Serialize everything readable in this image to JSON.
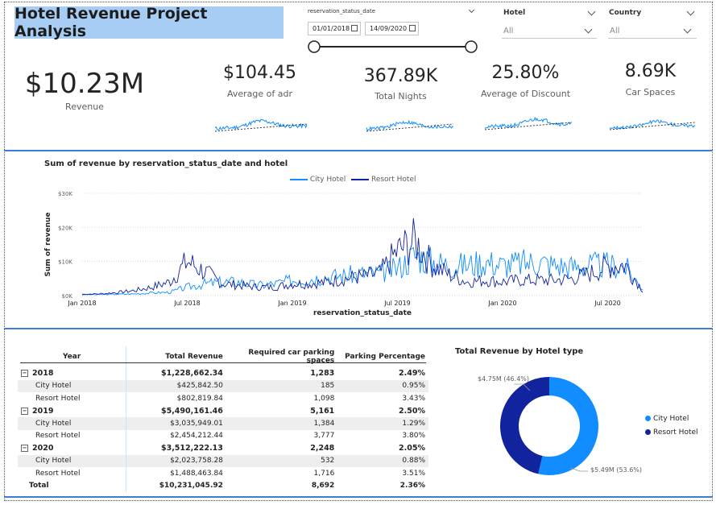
{
  "header": {
    "title": "Hotel Revenue Project Analysis"
  },
  "filters": {
    "date_label": "reservation_status_date",
    "date_start": "01/01/2018",
    "date_end": "14/09/2020",
    "hotel_label": "Hotel",
    "hotel_value": "All",
    "country_label": "Country",
    "country_value": "All"
  },
  "kpis": [
    {
      "value": "$10.23M",
      "label": "Revenue"
    },
    {
      "value": "$104.45",
      "label": "Average of adr"
    },
    {
      "value": "367.89K",
      "label": "Total Nights"
    },
    {
      "value": "25.80%",
      "label": "Average of Discount"
    },
    {
      "value": "8.69K",
      "label": "Car Spaces"
    }
  ],
  "colors": {
    "city": "#118dff",
    "resort": "#12239e",
    "title_bg": "#a8cdf5",
    "divider": "#3b7dd8"
  },
  "line_chart": {
    "title": "Sum of revenue by reservation_status_date and hotel",
    "legend": [
      "City Hotel",
      "Resort Hotel"
    ],
    "y_ticks": [
      "$30K",
      "$20K",
      "$10K",
      "$0K"
    ],
    "x_ticks": [
      "Jan 2018",
      "Jul 2018",
      "Jan 2019",
      "Jul 2019",
      "Jan 2020",
      "Jul 2020"
    ],
    "xlabel": "reservation_status_date",
    "ylabel": "Sum of revenue"
  },
  "chart_data": [
    {
      "type": "line",
      "title": "Sum of revenue by reservation_status_date and hotel",
      "xlabel": "reservation_status_date",
      "ylabel": "Sum of revenue",
      "ylim": [
        0,
        30000
      ],
      "x": [
        "2018-01",
        "2018-02",
        "2018-03",
        "2018-04",
        "2018-05",
        "2018-06",
        "2018-07",
        "2018-08",
        "2018-09",
        "2018-10",
        "2018-11",
        "2018-12",
        "2019-01",
        "2019-02",
        "2019-03",
        "2019-04",
        "2019-05",
        "2019-06",
        "2019-07",
        "2019-08",
        "2019-09",
        "2019-10",
        "2019-11",
        "2019-12",
        "2020-01",
        "2020-02",
        "2020-03",
        "2020-04",
        "2020-05",
        "2020-06",
        "2020-07",
        "2020-08",
        "2020-09"
      ],
      "series": [
        {
          "name": "City Hotel",
          "values": [
            300,
            300,
            400,
            500,
            800,
            1000,
            2500,
            3500,
            4000,
            4000,
            3000,
            3500,
            4500,
            5000,
            5500,
            6000,
            6500,
            6500,
            8000,
            12000,
            10000,
            9000,
            9000,
            10000,
            9000,
            9500,
            10000,
            9000,
            8500,
            9000,
            9000,
            8500,
            2000
          ]
        },
        {
          "name": "Resort Hotel",
          "values": [
            400,
            500,
            900,
            1500,
            2500,
            4000,
            10000,
            7000,
            3500,
            3000,
            2500,
            2500,
            3500,
            3500,
            4000,
            5000,
            5500,
            6500,
            13000,
            16000,
            9000,
            6000,
            4000,
            4500,
            4000,
            4500,
            4500,
            4500,
            5000,
            6500,
            8500,
            9000,
            1500
          ]
        }
      ],
      "legend": "top"
    },
    {
      "type": "pie",
      "title": "Total Revenue by Hotel type",
      "categories": [
        "City Hotel",
        "Resort Hotel"
      ],
      "values": [
        5.49,
        4.75
      ],
      "labels": [
        "$5.49M (53.6%)",
        "$4.75M (46.4%)"
      ],
      "legend": "right"
    }
  ],
  "matrix": {
    "headers": [
      "Year",
      "Total Revenue",
      "Required car parking spaces",
      "Parking Percentage"
    ],
    "rows": [
      {
        "kind": "year",
        "label": "2018",
        "revenue": "$1,228,662.34",
        "parking": "1,283",
        "pct": "2.49%"
      },
      {
        "kind": "sub",
        "label": "City Hotel",
        "revenue": "$425,842.50",
        "parking": "185",
        "pct": "0.95%"
      },
      {
        "kind": "sub",
        "label": "Resort Hotel",
        "revenue": "$802,819.84",
        "parking": "1,098",
        "pct": "3.43%"
      },
      {
        "kind": "year",
        "label": "2019",
        "revenue": "$5,490,161.46",
        "parking": "5,161",
        "pct": "2.50%"
      },
      {
        "kind": "sub",
        "label": "City Hotel",
        "revenue": "$3,035,949.01",
        "parking": "1,384",
        "pct": "1.29%"
      },
      {
        "kind": "sub",
        "label": "Resort Hotel",
        "revenue": "$2,454,212.44",
        "parking": "3,777",
        "pct": "3.80%"
      },
      {
        "kind": "year",
        "label": "2020",
        "revenue": "$3,512,222.13",
        "parking": "2,248",
        "pct": "2.05%"
      },
      {
        "kind": "sub",
        "label": "City Hotel",
        "revenue": "$2,023,758.28",
        "parking": "532",
        "pct": "0.88%"
      },
      {
        "kind": "sub",
        "label": "Resort Hotel",
        "revenue": "$1,488,463.84",
        "parking": "1,716",
        "pct": "3.51%"
      },
      {
        "kind": "total",
        "label": "Total",
        "revenue": "$10,231,045.92",
        "parking": "8,692",
        "pct": "2.36%"
      }
    ]
  },
  "donut": {
    "title": "Total Revenue by Hotel type",
    "label_resort": "$4.75M (46.4%)",
    "label_city": "$5.49M (53.6%)",
    "legend_city": "City Hotel",
    "legend_resort": "Resort Hotel"
  }
}
